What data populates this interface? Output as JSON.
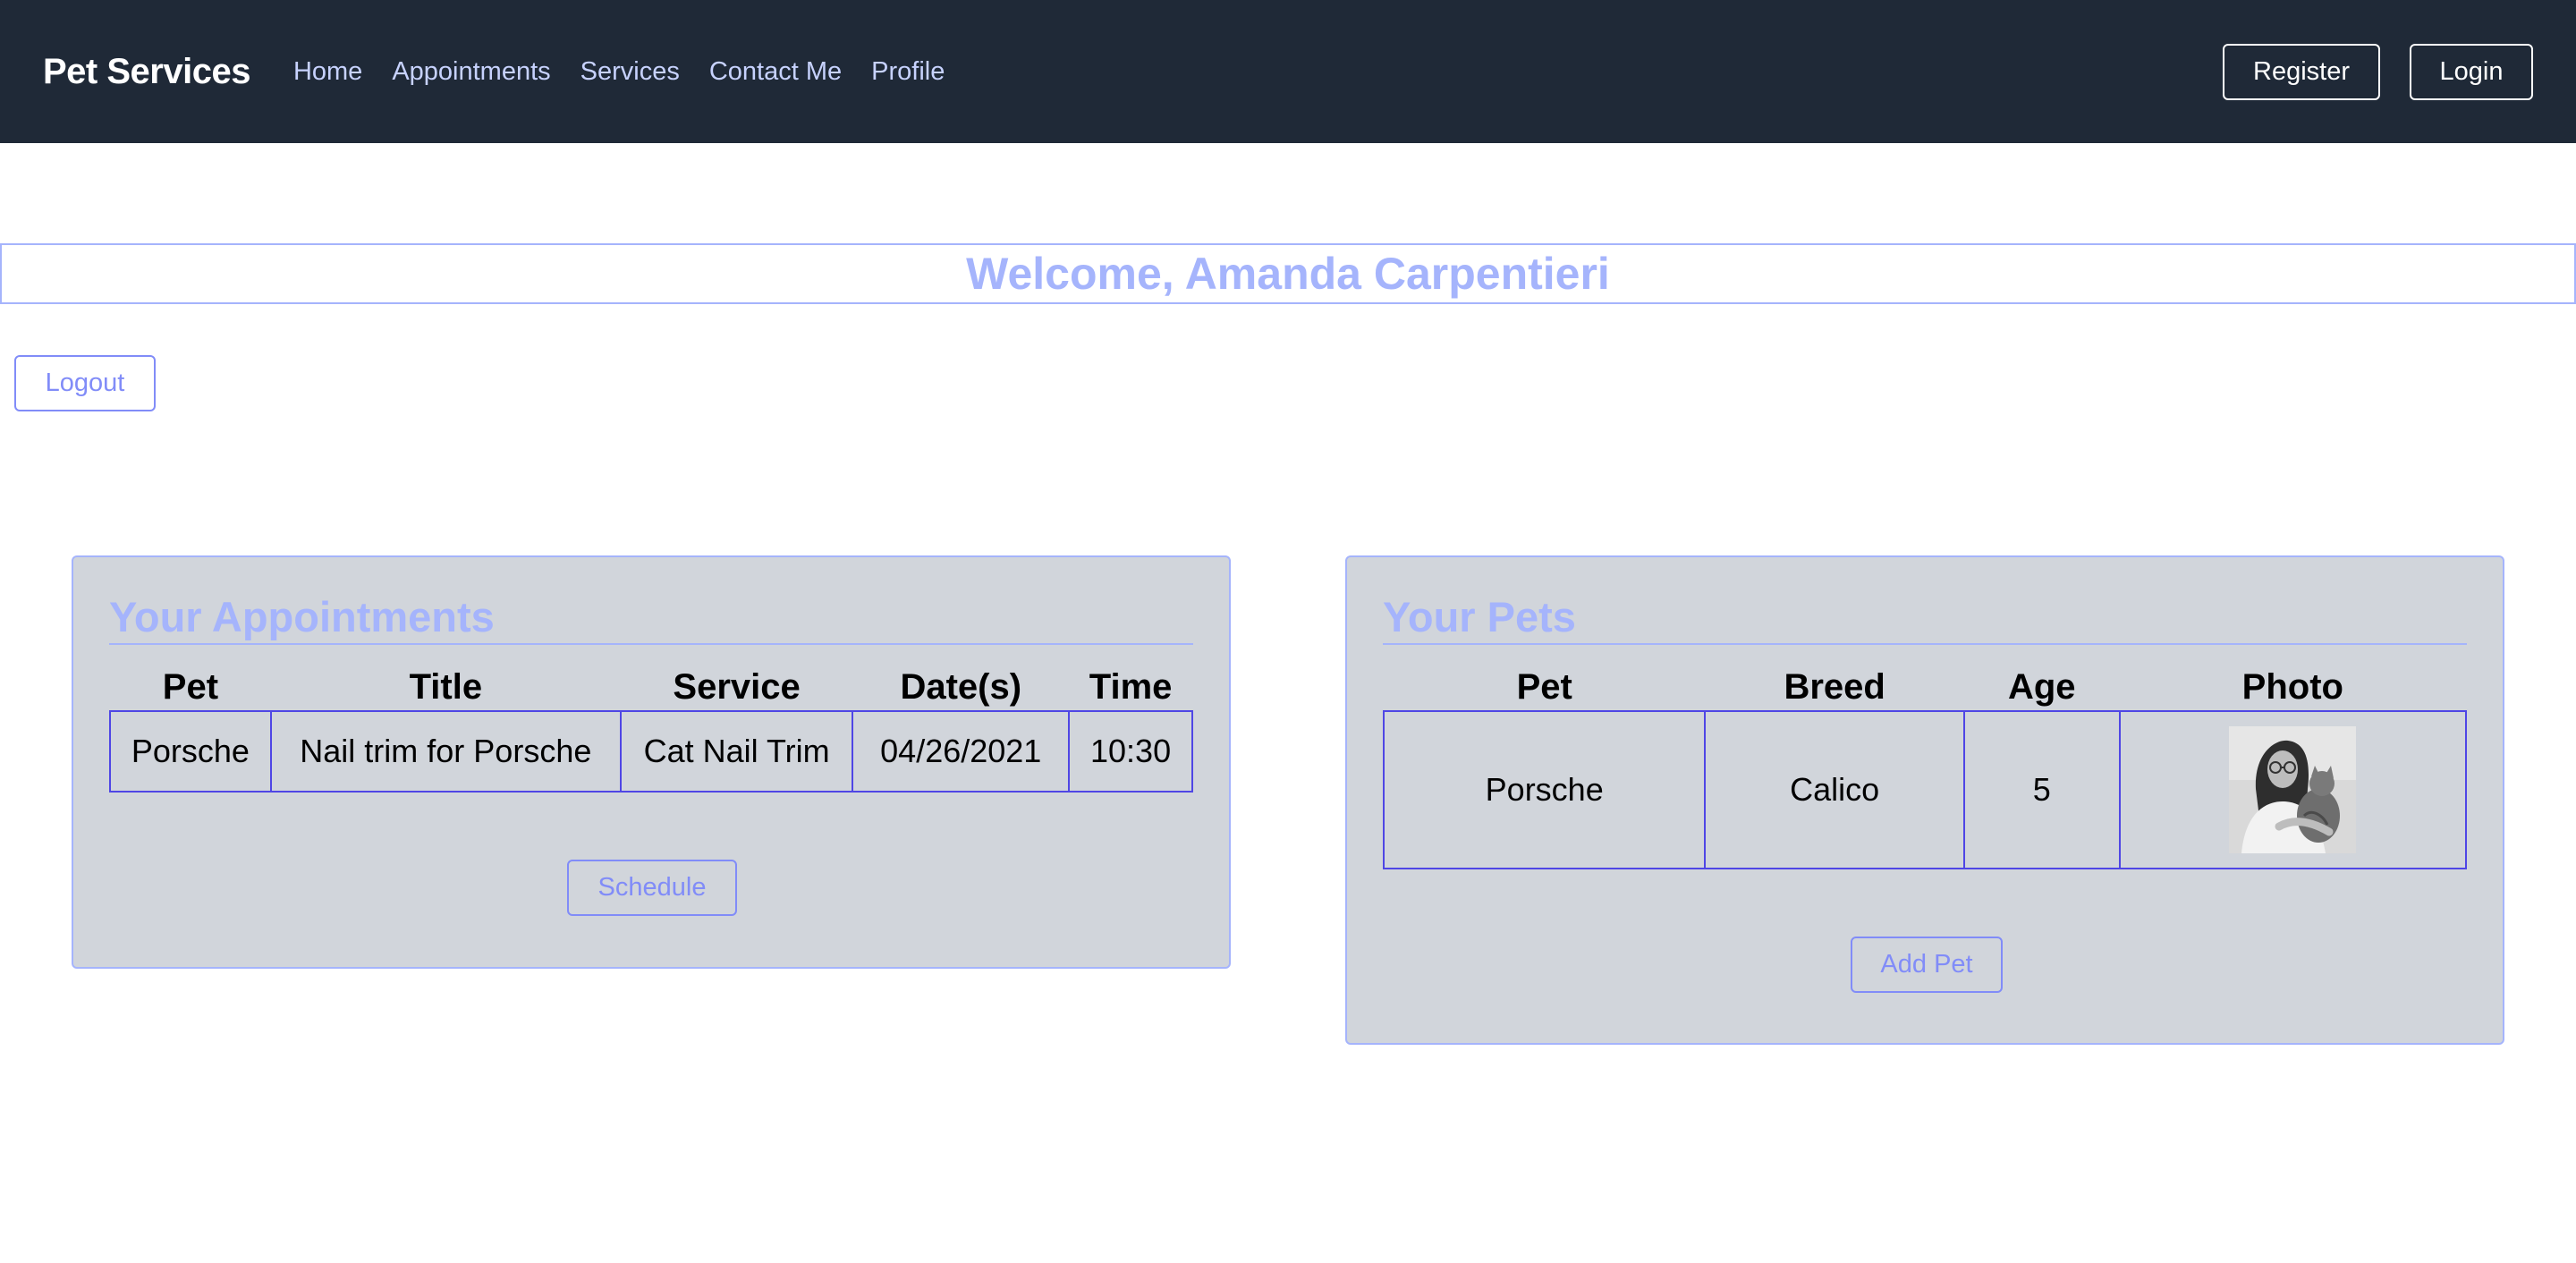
{
  "nav": {
    "brand": "Pet Services",
    "links": [
      "Home",
      "Appointments",
      "Services",
      "Contact Me",
      "Profile"
    ],
    "register_label": "Register",
    "login_label": "Login"
  },
  "welcome": "Welcome, Amanda Carpentieri",
  "logout_label": "Logout",
  "appointments": {
    "title": "Your Appointments",
    "headers": [
      "Pet",
      "Title",
      "Service",
      "Date(s)",
      "Time"
    ],
    "rows": [
      [
        "Porsche",
        "Nail trim for Porsche",
        "Cat Nail Trim",
        "04/26/2021",
        "10:30"
      ]
    ],
    "button_label": "Schedule"
  },
  "pets": {
    "title": "Your Pets",
    "headers": [
      "Pet",
      "Breed",
      "Age",
      "Photo"
    ],
    "rows": [
      [
        "Porsche",
        "Calico",
        "5"
      ]
    ],
    "button_label": "Add Pet"
  },
  "colors": {
    "navbar": "#1f2937",
    "accent": "#a5b4fc",
    "button_accent": "#818cf8",
    "table_border": "#4f46e5",
    "card_bg": "#d1d5db"
  }
}
